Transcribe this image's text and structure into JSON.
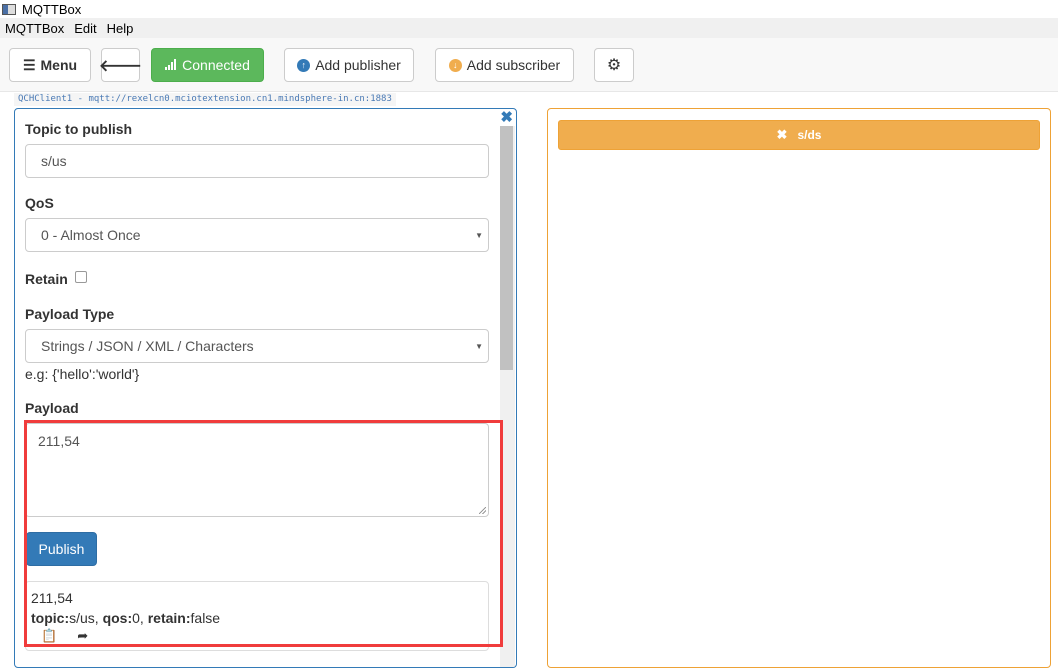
{
  "window": {
    "title": "MQTTBox"
  },
  "menubar": {
    "items": [
      "MQTTBox",
      "Edit",
      "Help"
    ]
  },
  "toolbar": {
    "menu_label": "Menu",
    "connected_label": "Connected",
    "add_publisher_label": "Add publisher",
    "add_subscriber_label": "Add subscriber",
    "colors": {
      "connected": "#5cb85c",
      "publisher_icon": "#337ab7",
      "subscriber_icon": "#f0ad4e"
    }
  },
  "client": {
    "label": "QCHClient1 - mqtt://rexelcn0.mciotextension.cn1.mindsphere-in.cn:1883"
  },
  "publisher": {
    "topic_label": "Topic to publish",
    "topic_value": "s/us",
    "qos_label": "QoS",
    "qos_value": "0 - Almost Once",
    "retain_label": "Retain",
    "retain_checked": false,
    "payload_type_label": "Payload Type",
    "payload_type_value": "Strings / JSON / XML / Characters",
    "payload_hint": "e.g: {'hello':'world'}",
    "payload_label": "Payload",
    "payload_value": "211,54",
    "publish_label": "Publish",
    "published_message": {
      "payload": "211,54",
      "topic_key": "topic:",
      "topic_val": "s/us, ",
      "qos_key": "qos:",
      "qos_val": "0, ",
      "retain_key": "retain:",
      "retain_val": "false"
    }
  },
  "subscriber": {
    "topic": "s/ds",
    "color": "#f0ad4e"
  }
}
